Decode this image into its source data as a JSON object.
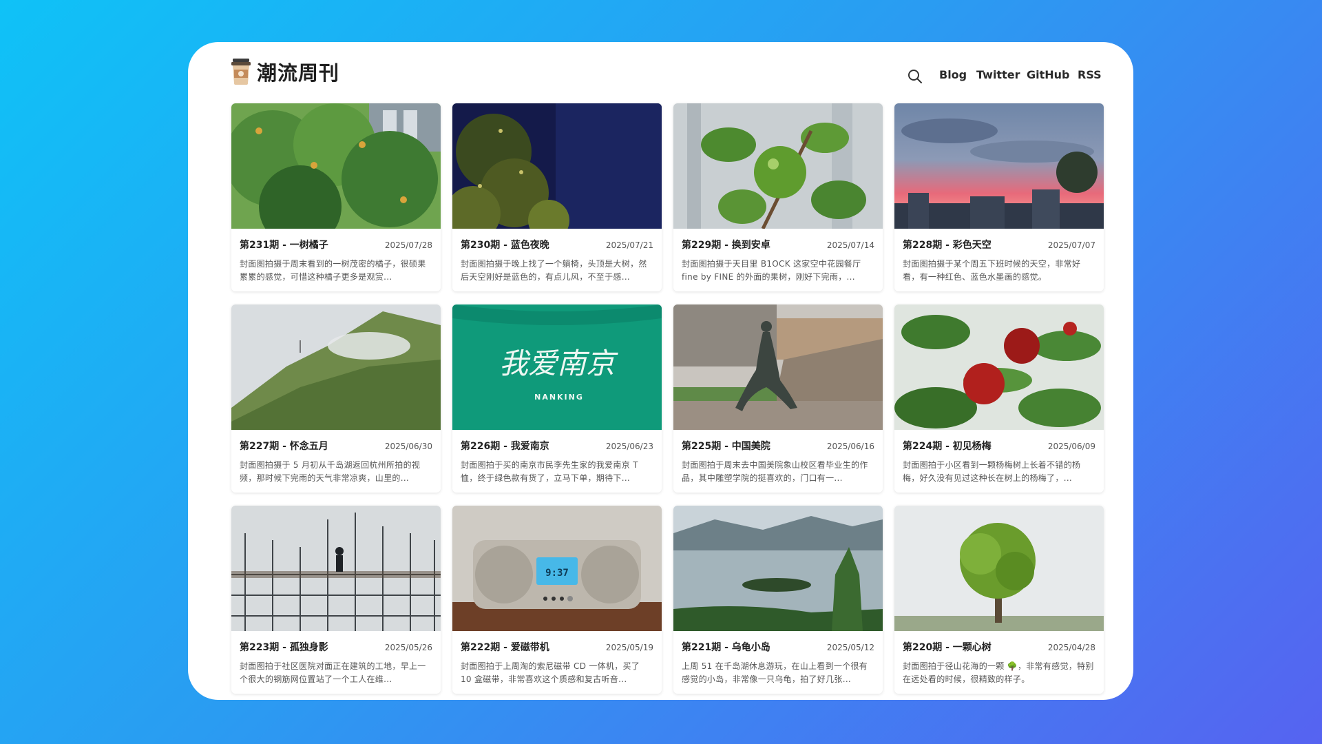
{
  "site": {
    "title": "潮流周刊"
  },
  "nav": {
    "blog": "Blog",
    "twitter": "Twitter",
    "github": "GitHub",
    "rss": "RSS"
  },
  "icons": {
    "logo": "coffee-cup-icon",
    "search": "search-icon"
  },
  "colors": {
    "background_start": "#0fc2f7",
    "background_end": "#5663f1",
    "card_bg": "#ffffff"
  },
  "cards": [
    {
      "title": "第231期 - 一树橘子",
      "date": "2025/07/28",
      "desc": "封面图拍摄于周末看到的一树茂密的橘子，很硕果累累的感觉，可惜这种橘子更多是观赏..."
    },
    {
      "title": "第230期 - 蓝色夜晚",
      "date": "2025/07/21",
      "desc": "封面图拍摄于晚上找了一个躺椅，头顶是大树，然后天空刚好是蓝色的，有点儿风，不至于感..."
    },
    {
      "title": "第229期 - 换到安卓",
      "date": "2025/07/14",
      "desc": "封面图拍摄于天目里 B1OCK 这家空中花园餐厅 fine by FINE 的外面的果树，刚好下完雨，..."
    },
    {
      "title": "第228期 - 彩色天空",
      "date": "2025/07/07",
      "desc": "封面图拍摄于某个周五下班时候的天空，非常好看，有一种红色、蓝色水墨画的感觉。"
    },
    {
      "title": "第227期 - 怀念五月",
      "date": "2025/06/30",
      "desc": "封面图拍摄于 5 月初从千岛湖返回杭州所拍的视频，那时候下完雨的天气非常凉爽，山里的..."
    },
    {
      "title": "第226期 - 我爱南京",
      "date": "2025/06/23",
      "desc": "封面图拍于买的南京市民李先生家的我爱南京 T 恤，终于绿色款有货了，立马下单，期待下..."
    },
    {
      "title": "第225期 - 中国美院",
      "date": "2025/06/16",
      "desc": "封面图拍于周末去中国美院象山校区看毕业生的作品，其中雕塑学院的挺喜欢的，门口有一..."
    },
    {
      "title": "第224期 - 初见杨梅",
      "date": "2025/06/09",
      "desc": "封面图拍于小区看到一颗杨梅树上长着不错的杨梅，好久没有见过这种长在树上的杨梅了，..."
    },
    {
      "title": "第223期 - 孤独身影",
      "date": "2025/05/26",
      "desc": "封面图拍于社区医院对面正在建筑的工地，早上一个很大的钢筋网位置站了一个工人在维..."
    },
    {
      "title": "第222期 - 爱磁带机",
      "date": "2025/05/19",
      "desc": "封面图拍于上周淘的索尼磁带 CD 一体机，买了 10 盒磁带，非常喜欢这个质感和复古听音..."
    },
    {
      "title": "第221期 - 乌龟小岛",
      "date": "2025/05/12",
      "desc": "上周 51 在千岛湖休息游玩，在山上看到一个很有感觉的小岛，非常像一只乌龟，拍了好几张..."
    },
    {
      "title": "第220期 - 一颗心树",
      "date": "2025/04/28",
      "desc": "封面图拍于径山花海的一颗 🌳，非常有感觉，特别在远处看的时候，很精致的样子。"
    }
  ],
  "thumbs": {
    "c0": {
      "label": "",
      "display": "",
      "bg": "#4f8a3a"
    },
    "c5": {
      "label": "我爱南京",
      "display": "NANKING",
      "bg": "#0f9a7a"
    },
    "c9": {
      "label": "",
      "display": "9:37",
      "bg": "#bfbab0"
    }
  }
}
